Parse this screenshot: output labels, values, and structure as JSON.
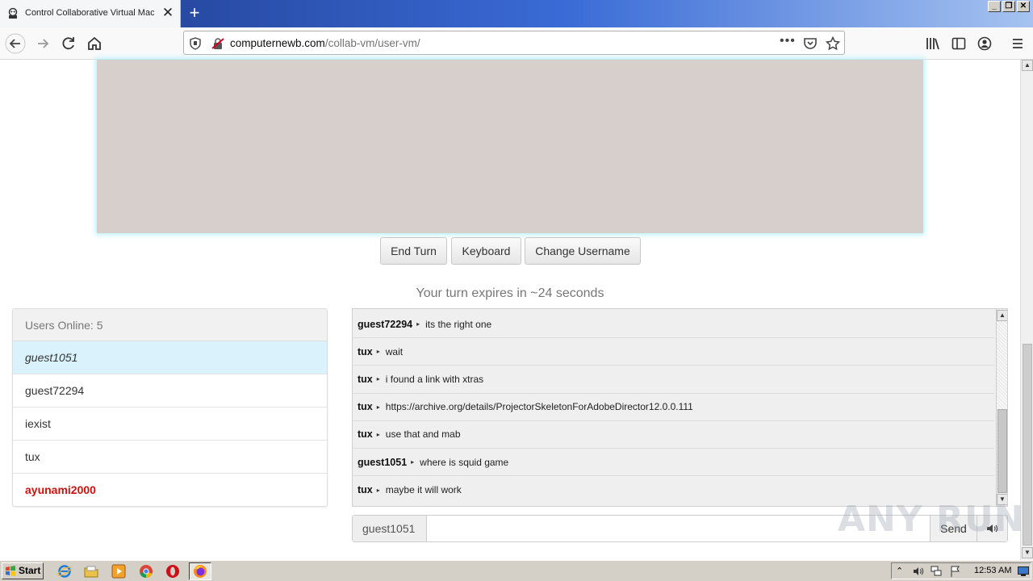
{
  "browser": {
    "tab_title": "Control Collaborative Virtual Machine",
    "url_domain": "computernewb.com",
    "url_path": "/collab-vm/user-vm/"
  },
  "vm": {
    "buttons": {
      "end_turn": "End Turn",
      "keyboard": "Keyboard",
      "change_username": "Change Username"
    },
    "turn_status": "Your turn expires in ~24 seconds"
  },
  "users": {
    "header": "Users Online: 5",
    "list": [
      "guest1051",
      "guest72294",
      "iexist",
      "tux",
      "ayunami2000"
    ]
  },
  "chat": {
    "messages": [
      {
        "user": "guest72294",
        "text": "its the right one"
      },
      {
        "user": "tux",
        "text": "wait"
      },
      {
        "user": "tux",
        "text": "i found a link with xtras"
      },
      {
        "user": "tux",
        "text": "https://archive.org/details/ProjectorSkeletonForAdobeDirector12.0.0.111"
      },
      {
        "user": "tux",
        "text": "use that and mab"
      },
      {
        "user": "guest1051",
        "text": "where is squid game"
      },
      {
        "user": "tux",
        "text": "maybe it will work"
      }
    ],
    "arrow_glyph": "▸",
    "input_username": "guest1051",
    "input_value": "",
    "send_label": "Send"
  },
  "watermark": "ANY RUN",
  "taskbar": {
    "start_label": "Start",
    "time": "12:53 AM"
  }
}
